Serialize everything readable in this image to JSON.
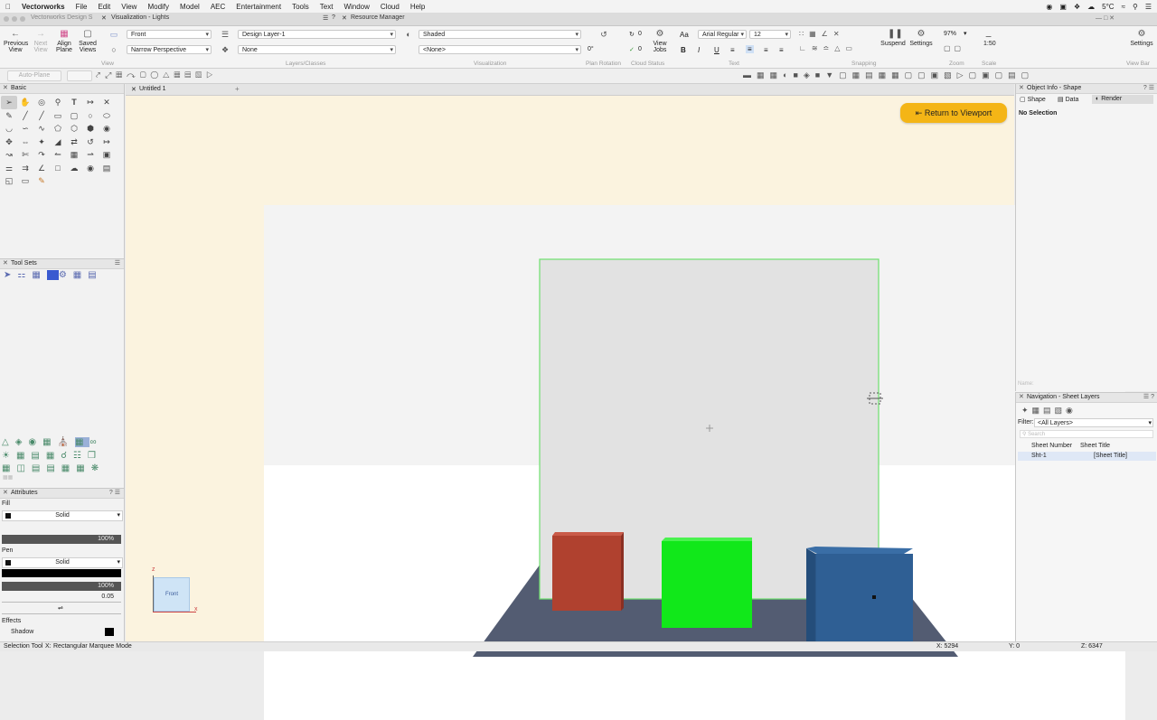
{
  "menubar": {
    "app": "Vectorworks",
    "items": [
      "File",
      "Edit",
      "View",
      "Modify",
      "Model",
      "AEC",
      "Entertainment",
      "Tools",
      "Text",
      "Window",
      "Cloud",
      "Help"
    ],
    "weather": "5°C",
    "right_icons": [
      "record-icon",
      "camera-icon",
      "dropbox-icon",
      "cloud-icon",
      "wifi-icon",
      "search-icon",
      "control-center-icon"
    ]
  },
  "windows": {
    "main_tab": "Vectorworks Design S",
    "viz_tab": "Visualization - Lights",
    "rm_tab": "Resource Manager"
  },
  "toolbar": {
    "previous_view": [
      "Previous",
      "View"
    ],
    "next_view": [
      "Next",
      "View"
    ],
    "align_plane": [
      "Align",
      "Plane"
    ],
    "saved_views": [
      "Saved",
      "Views"
    ],
    "group_view": "View",
    "view_select": "Front",
    "projection_select": "Narrow Perspective",
    "layer_select": "Design Layer-1",
    "class_select": "None",
    "group_layers": "Layers/Classes",
    "render_select": "Shaded",
    "render_sub_select": "<None>",
    "group_visualization": "Visualization",
    "plan_rotation_value": "0°",
    "group_plan_rotation": "Plan Rotation",
    "cloud_count_1": "0",
    "cloud_count_2": "0",
    "view_jobs": [
      "View",
      "Jobs"
    ],
    "group_cloud": "Cloud Status",
    "font_select": "Arial Regular",
    "font_size": "12",
    "bold": "B",
    "italic": "I",
    "underline": "U",
    "group_text": "Text",
    "group_snapping": "Snapping",
    "suspend": "Suspend",
    "settings": "Settings",
    "zoom_value": "97%",
    "group_zoom": "Zoom",
    "scale_value": "1:50",
    "group_scale": "Scale",
    "viewbar_settings": "Settings",
    "group_viewbar": "View Bar"
  },
  "modebar": {
    "auto_plane": "Auto-Plane"
  },
  "palettes": {
    "basic_title": "Basic",
    "toolsets_title": "Tool Sets",
    "attributes_title": "Attributes",
    "fill_label": "Fill",
    "fill_style": "Solid",
    "fill_opacity": "100%",
    "pen_label": "Pen",
    "pen_style": "Solid",
    "pen_opacity": "100%",
    "line_weight": "0.05",
    "effects_label": "Effects",
    "shadow_label": "Shadow"
  },
  "document": {
    "tab": "Untitled 1",
    "return_button": "Return to Viewport",
    "view_cube_label": "Front",
    "axis_z": "z",
    "axis_x": "x"
  },
  "object_info": {
    "title": "Object Info - Shape",
    "tabs": [
      "Shape",
      "Data",
      "Render"
    ],
    "selection": "No Selection",
    "name_label": "Name:"
  },
  "navigation": {
    "title": "Navigation - Sheet Layers",
    "filter_label": "Filter:",
    "filter_value": "<All Layers>",
    "search_placeholder": "Search",
    "col_number": "Sheet Number",
    "col_title": "Sheet Title",
    "rows": [
      {
        "number": "Sht-1",
        "title": "[Sheet Title]"
      }
    ]
  },
  "status": {
    "tool": "Selection Tool",
    "mode_key": "X:",
    "mode": "Rectangular Marquee Mode",
    "x": "X: 5294",
    "y": "Y: 0",
    "z": "Z: 6347"
  },
  "colors": {
    "selection_green": "#6ee06e",
    "red_cube": "#b0412f",
    "green_cube": "#11e81a",
    "blue_cube": "#2f5f94",
    "floor": "#535c72",
    "return_button": "#f4b516",
    "canvas_border": "#fbf3df"
  }
}
